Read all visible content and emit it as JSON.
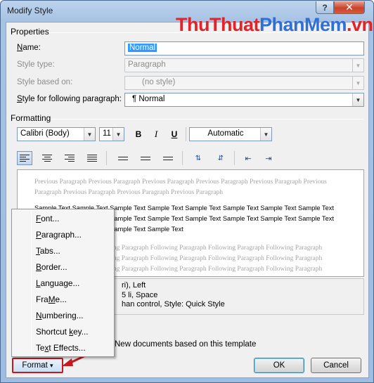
{
  "window": {
    "title": "Modify Style",
    "help": "?",
    "close": "✕"
  },
  "watermark": {
    "part1": "ThuThuat",
    "part2": "PhanMem",
    "part3": ".vn"
  },
  "properties": {
    "group_label": "Properties",
    "name_label_u": "N",
    "name_label_rest": "ame:",
    "name_value": "Normal",
    "style_type_label": "Style type:",
    "style_type_value": "Paragraph",
    "based_on_label": "Style based on:",
    "based_on_value": "(no style)",
    "following_label_u": "S",
    "following_label_rest": "tyle for following paragraph:",
    "following_value": "¶ Normal"
  },
  "formatting": {
    "group_label": "Formatting",
    "font": "Calibri (Body)",
    "size": "11",
    "bold": "B",
    "italic": "I",
    "underline": "U",
    "color": "Automatic"
  },
  "preview": {
    "previous": "Previous Paragraph Previous Paragraph Previous Paragraph Previous Paragraph Previous Paragraph Previous Paragraph Previous Paragraph Previous Paragraph Previous Paragraph",
    "sample1": "Sample Text Sample Text Sample Text Sample Text Sample Text Sample Text Sample Text Sample Text",
    "sample2": "Sample Text Sample Text Sample Text Sample Text Sample Text Sample Text Sample Text Sample Text",
    "sample3": "Sample Text Sample Text Sample Text Sample Text",
    "following": "Following Paragraph Following Paragraph Following Paragraph Following Paragraph Following Paragraph Following Paragraph Following Paragraph Following Paragraph Following Paragraph Following Paragraph Following Paragraph Following Paragraph Following Paragraph Following Paragraph Following Paragraph Following Paragraph"
  },
  "description": {
    "line1": "ri), Left",
    "line2": "5 li, Space",
    "line3": "han control, Style: Quick Style"
  },
  "options": {
    "new_docs_label": "New documents based on this template"
  },
  "menu": {
    "items": [
      {
        "u": "F",
        "rest": "ont..."
      },
      {
        "u": "P",
        "rest": "aragraph..."
      },
      {
        "u": "T",
        "rest": "abs..."
      },
      {
        "u": "B",
        "rest": "order..."
      },
      {
        "u": "L",
        "rest": "anguage..."
      },
      {
        "u": "M",
        "pre": "Fra",
        "rest": "e..."
      },
      {
        "u": "N",
        "rest": "umbering..."
      },
      {
        "pre": "Shortcut ",
        "u": "k",
        "rest": "ey..."
      },
      {
        "pre": "Te",
        "u": "x",
        "rest": "t Effects..."
      }
    ]
  },
  "buttons": {
    "format": "Format",
    "format_arrow": "▾",
    "ok": "OK",
    "cancel": "Cancel"
  },
  "colors": {
    "annotation_red": "#c8181e",
    "selection": "#3399ff"
  }
}
